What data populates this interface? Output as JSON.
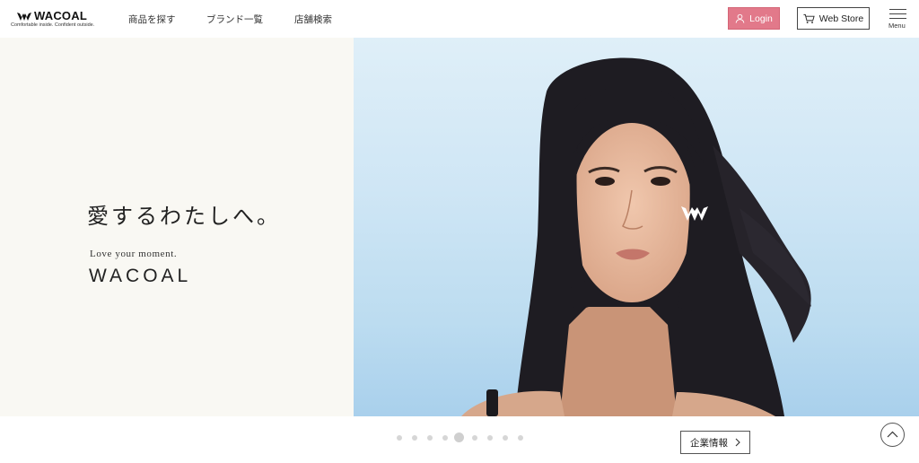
{
  "header": {
    "logo_word": "WACOAL",
    "logo_tagline": "Comfortable inside. Confident outside.",
    "nav": [
      "商品を探す",
      "ブランド一覧",
      "店舗検索"
    ],
    "login_label": "Login",
    "webstore_label": "Web Store",
    "menu_label": "Menu"
  },
  "hero": {
    "headline": "愛するわたしへ。",
    "tagline": "Love your moment.",
    "brand": "WACOAL"
  },
  "carousel": {
    "slide_count": 9,
    "active_index": 4
  },
  "footer": {
    "corporate_label": "企業情報"
  },
  "colors": {
    "login_bg": "#e2798a",
    "hero_left_bg": "#f9f8f3",
    "sky_top": "#dfeff8",
    "sky_bottom": "#a9d0ec"
  },
  "icons": [
    "wacoal-logo-icon",
    "user-icon",
    "cart-icon",
    "hamburger-icon",
    "chevron-right-icon",
    "chevron-up-icon"
  ]
}
